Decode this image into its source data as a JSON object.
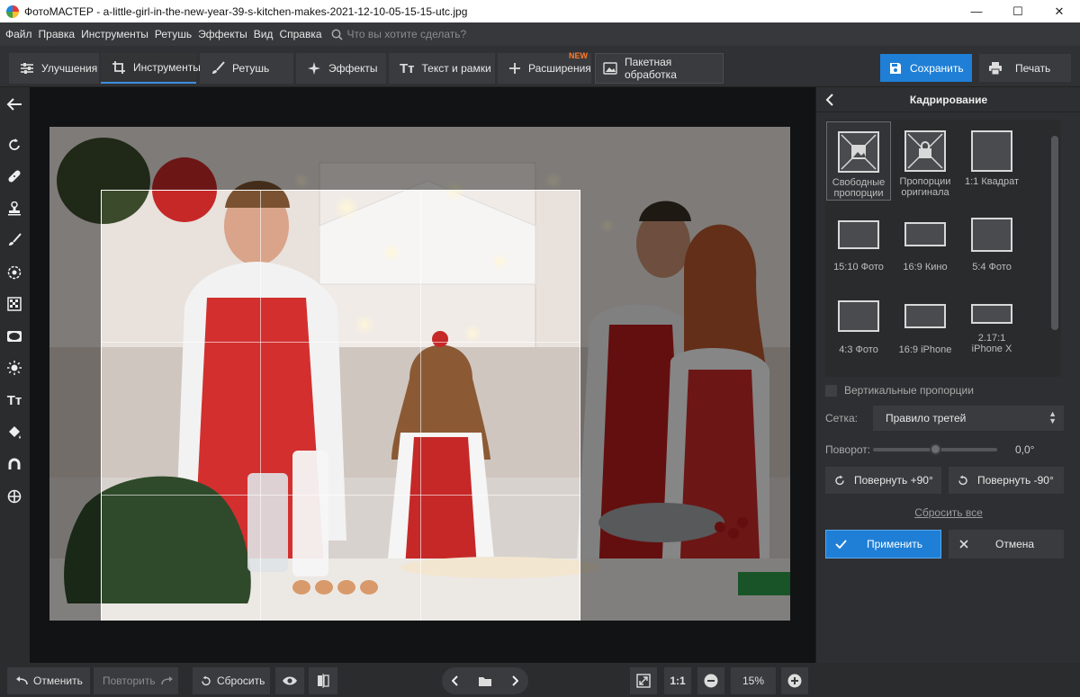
{
  "window": {
    "title": "ФотоМАСТЕР - a-little-girl-in-the-new-year-39-s-kitchen-makes-2021-12-10-05-15-15-utc.jpg",
    "minimize": "—",
    "maximize": "☐",
    "close": "✕"
  },
  "menu": {
    "items": [
      "Файл",
      "Правка",
      "Инструменты",
      "Ретушь",
      "Эффекты",
      "Вид",
      "Справка"
    ],
    "search_placeholder": "Что вы хотите сделать?"
  },
  "toolbar": {
    "tabs": [
      {
        "label": "Улучшения",
        "icon": "sliders-icon"
      },
      {
        "label": "Инструменты",
        "icon": "crop-icon",
        "active": true
      },
      {
        "label": "Ретушь",
        "icon": "brush-icon"
      },
      {
        "label": "Эффекты",
        "icon": "sparkle-icon"
      },
      {
        "label": "Текст и рамки",
        "icon": "text-icon"
      },
      {
        "label": "Расширения",
        "icon": "plus-icon",
        "badge": "NEW"
      },
      {
        "label": "Пакетная обработка",
        "icon": "images-icon"
      }
    ],
    "save_label": "Сохранить",
    "print_label": "Печать"
  },
  "leftbar": {
    "icons": [
      "back-arrow-icon",
      "rotate-icon",
      "bandage-icon",
      "stamp-icon",
      "brush-icon",
      "target-icon",
      "grid-icon",
      "vignette-icon",
      "light-icon",
      "text-icon",
      "fill-icon",
      "magnet-icon",
      "crosshair-icon"
    ]
  },
  "panel": {
    "title": "Кадрирование",
    "presets": [
      {
        "label": "Свободные пропорции",
        "selected": true
      },
      {
        "label": "Пропорции оригинала"
      },
      {
        "label": "1:1 Квадрат"
      },
      {
        "label": "15:10 Фото"
      },
      {
        "label": "16:9 Кино"
      },
      {
        "label": "5:4 Фото"
      },
      {
        "label": "4:3 Фото"
      },
      {
        "label": "16:9 iPhone"
      },
      {
        "label": "2.17:1 iPhone X"
      }
    ],
    "vertical_label": "Вертикальные пропорции",
    "grid_label": "Сетка:",
    "grid_value": "Правило третей",
    "rotation_label": "Поворот:",
    "rotation_value": "0,0°",
    "rotation_level": 0.5,
    "rotate_plus": "Повернуть +90°",
    "rotate_minus": "Повернуть -90°",
    "reset_all": "Сбросить все",
    "apply": "Применить",
    "cancel": "Отмена"
  },
  "bottom": {
    "undo": "Отменить",
    "redo": "Повторить",
    "reset": "Сбросить",
    "zoom_fit": "1:1",
    "zoom": "15%"
  },
  "colors": {
    "accent": "#1f7fd6",
    "new_badge": "#ff7a2a"
  }
}
